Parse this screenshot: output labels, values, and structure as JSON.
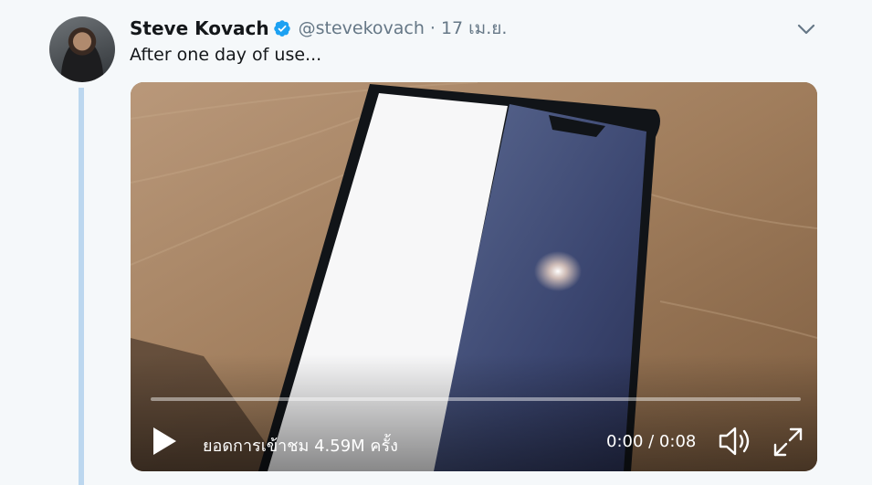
{
  "author": {
    "name": "Steve Kovach",
    "handle": "@stevekovach",
    "separator": "·",
    "date": "17 เม.ย.",
    "verified_icon": "verified-badge-icon"
  },
  "tweet": {
    "text": "After one day of use..."
  },
  "video": {
    "views_text": "ยอดการเข้าชม 4.59M ครั้ง",
    "time_text": "0:00 / 0:08",
    "progress": 0,
    "icons": {
      "play": "play-icon",
      "volume": "volume-icon",
      "fullscreen": "fullscreen-icon"
    }
  },
  "colors": {
    "background": "#f5f8fa",
    "verified": "#1da1f2",
    "muted_text": "#657786",
    "thread_line": "#bcd7ef"
  }
}
